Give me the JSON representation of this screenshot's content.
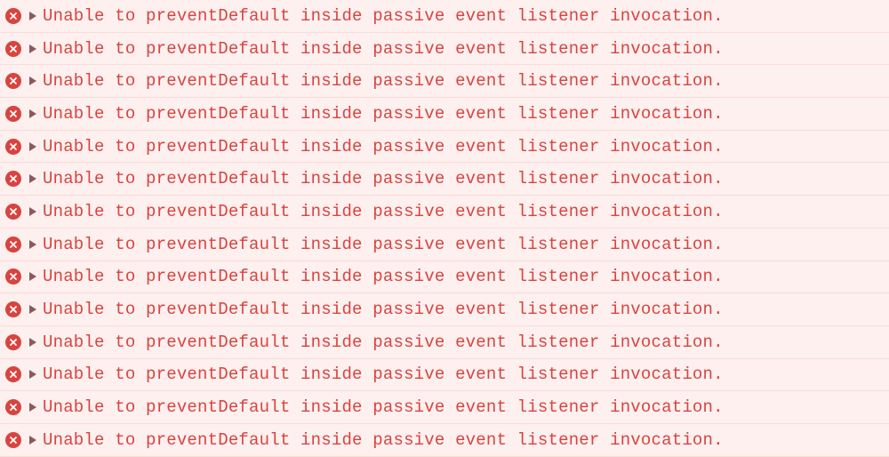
{
  "console": {
    "errors": [
      {
        "message": "Unable to preventDefault inside passive event listener invocation."
      },
      {
        "message": "Unable to preventDefault inside passive event listener invocation."
      },
      {
        "message": "Unable to preventDefault inside passive event listener invocation."
      },
      {
        "message": "Unable to preventDefault inside passive event listener invocation."
      },
      {
        "message": "Unable to preventDefault inside passive event listener invocation."
      },
      {
        "message": "Unable to preventDefault inside passive event listener invocation."
      },
      {
        "message": "Unable to preventDefault inside passive event listener invocation."
      },
      {
        "message": "Unable to preventDefault inside passive event listener invocation."
      },
      {
        "message": "Unable to preventDefault inside passive event listener invocation."
      },
      {
        "message": "Unable to preventDefault inside passive event listener invocation."
      },
      {
        "message": "Unable to preventDefault inside passive event listener invocation."
      },
      {
        "message": "Unable to preventDefault inside passive event listener invocation."
      },
      {
        "message": "Unable to preventDefault inside passive event listener invocation."
      },
      {
        "message": "Unable to preventDefault inside passive event listener invocation."
      }
    ]
  }
}
